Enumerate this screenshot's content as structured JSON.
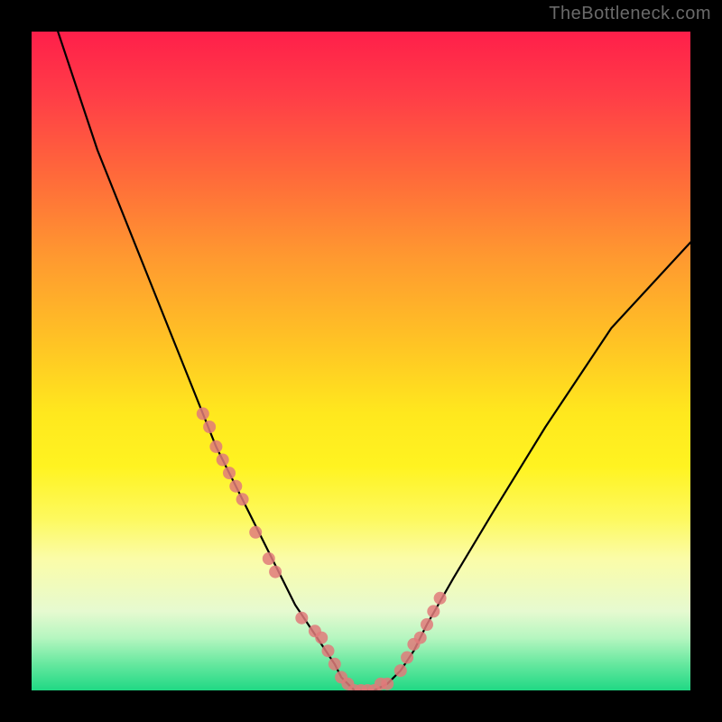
{
  "watermark": "TheBottleneck.com",
  "colors": {
    "page_background": "#000000",
    "curve": "#000000",
    "dots": "#e07a7a",
    "gradient_top": "#ff1f4a",
    "gradient_mid": "#ffe81e",
    "gradient_bottom": "#20d884"
  },
  "chart_data": {
    "type": "line",
    "title": "",
    "xlabel": "",
    "ylabel": "",
    "xlim": [
      0,
      100
    ],
    "ylim": [
      0,
      100
    ],
    "grid": false,
    "legend": false,
    "annotations": [
      "TheBottleneck.com"
    ],
    "series": [
      {
        "name": "bottleneck-curve",
        "x": [
          4,
          10,
          14,
          18,
          22,
          24,
          26,
          28,
          30,
          32,
          34,
          36,
          38,
          40,
          42,
          44,
          46,
          47,
          48,
          49,
          50,
          52,
          54,
          56,
          58,
          60,
          64,
          70,
          78,
          88,
          100
        ],
        "values": [
          100,
          82,
          72,
          62,
          52,
          47,
          42,
          37,
          33,
          29,
          25,
          21,
          17,
          13,
          10,
          7,
          4,
          2,
          1,
          0,
          0,
          0,
          1,
          3,
          6,
          10,
          17,
          27,
          40,
          55,
          68
        ]
      }
    ],
    "highlight_points": {
      "name": "curve-dots",
      "x": [
        26,
        27,
        28,
        29,
        30,
        31,
        32,
        34,
        36,
        37,
        41,
        43,
        44,
        45,
        46,
        47,
        48,
        49,
        50,
        51,
        52,
        53,
        54,
        56,
        57,
        58,
        59,
        60,
        61,
        62
      ],
      "values": [
        42,
        40,
        37,
        35,
        33,
        31,
        29,
        24,
        20,
        18,
        11,
        9,
        8,
        6,
        4,
        2,
        1,
        0,
        0,
        0,
        0,
        1,
        1,
        3,
        5,
        7,
        8,
        10,
        12,
        14
      ]
    }
  }
}
